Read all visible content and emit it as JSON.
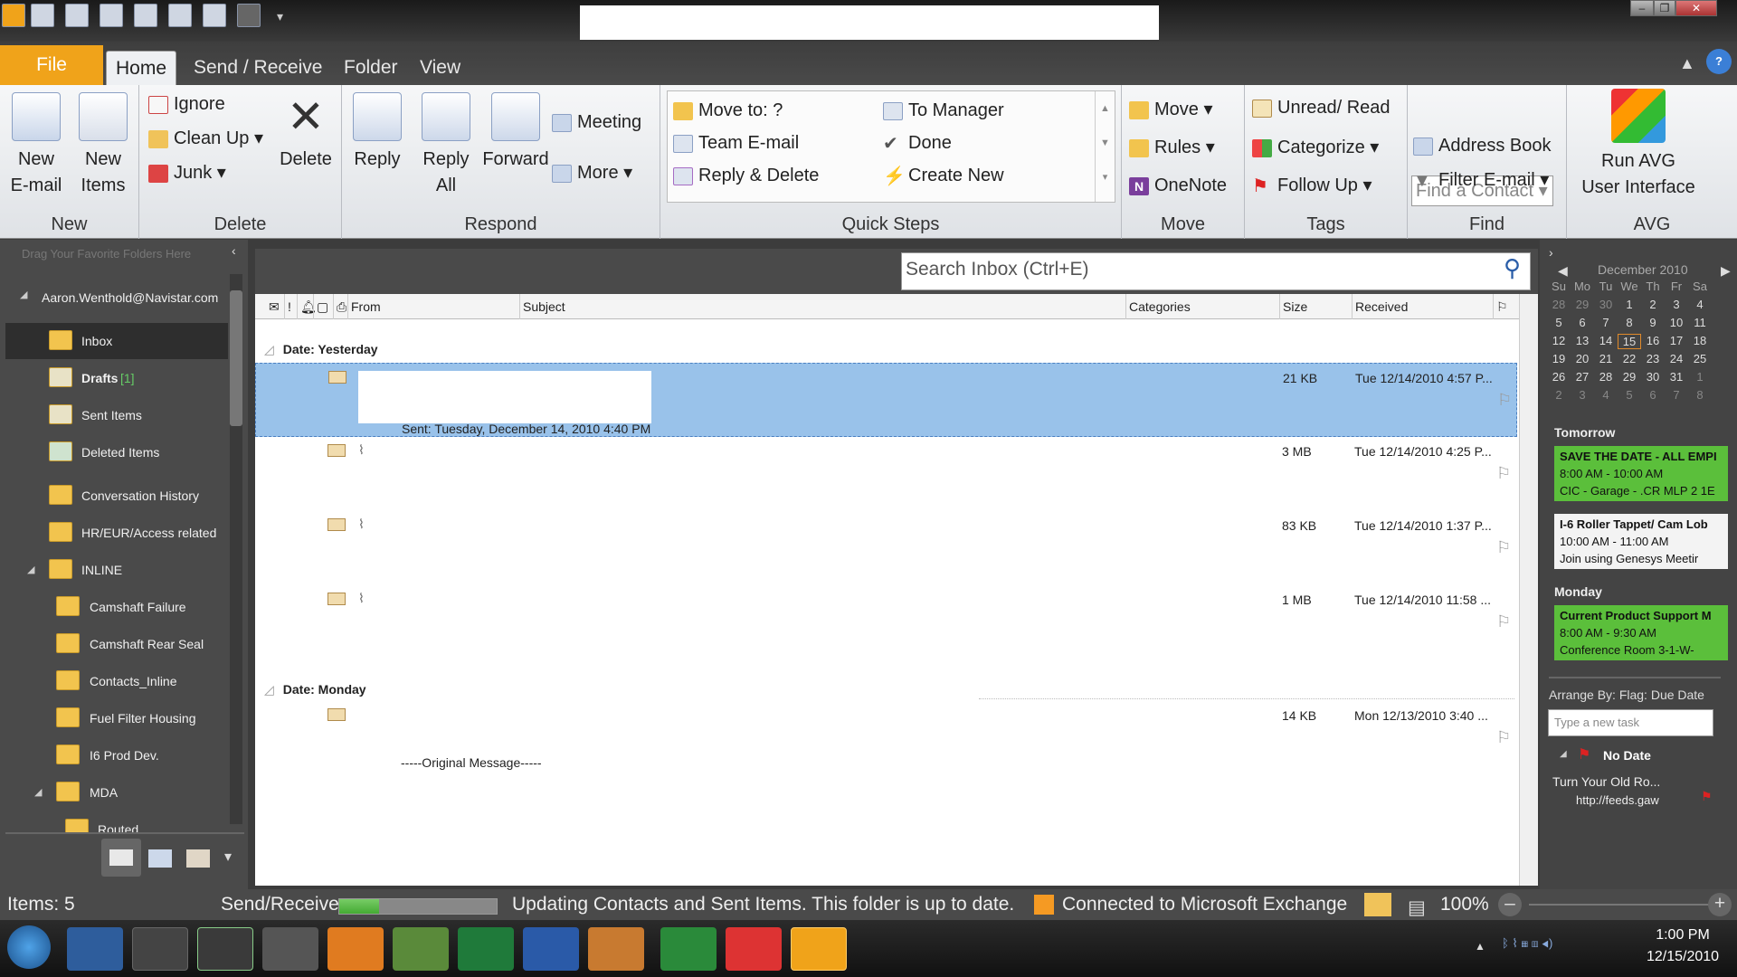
{
  "ribbon_tabs": [
    "File",
    "Home",
    "Send / Receive",
    "Folder",
    "View"
  ],
  "ribbon": {
    "new": {
      "new_email": "New\nE-mail",
      "new_items": "New\nItems",
      "label": "New"
    },
    "delete": {
      "ignore": "Ignore",
      "cleanup": "Clean Up",
      "junk": "Junk",
      "delete": "Delete",
      "label": "Delete"
    },
    "respond": {
      "reply": "Reply",
      "reply_all": "Reply\nAll",
      "forward": "Forward",
      "meeting": "Meeting",
      "more": "More",
      "label": "Respond"
    },
    "quicksteps": {
      "items": [
        "Move to: ?",
        "Team E-mail",
        "Reply & Delete",
        "To Manager",
        "Done",
        "Create New"
      ],
      "label": "Quick Steps"
    },
    "move": {
      "move": "Move",
      "rules": "Rules",
      "onenote": "OneNote",
      "label": "Move"
    },
    "tags": {
      "unread": "Unread/ Read",
      "categorize": "Categorize",
      "followup": "Follow Up",
      "label": "Tags"
    },
    "find": {
      "find_contact": "Find a Contact",
      "address_book": "Address Book",
      "filter_email": "Filter E-mail",
      "label": "Find"
    },
    "avg": {
      "run_avg": "Run AVG\nUser Interface",
      "label": "AVG"
    }
  },
  "nav": {
    "drag_hint": "Drag Your Favorite Folders Here",
    "account": "Aaron.Wenthold@Navistar.com",
    "folders": [
      "Inbox",
      "Drafts",
      "Sent Items",
      "Deleted Items",
      "Conversation History",
      "HR/EUR/Access related",
      "INLINE",
      "Camshaft Failure",
      "Camshaft Rear Seal",
      "Contacts_Inline",
      "Fuel Filter Housing",
      "I6 Prod Dev.",
      "MDA",
      "Routed"
    ],
    "drafts_count": "[1]"
  },
  "search": {
    "placeholder": "Search Inbox (Ctrl+E)"
  },
  "columns": {
    "from": "From",
    "subject": "Subject",
    "categories": "Categories",
    "size": "Size",
    "received": "Received"
  },
  "groups": {
    "yesterday": "Date: Yesterday",
    "monday": "Date: Monday"
  },
  "messages": [
    {
      "size": "21 KB",
      "received": "Tue 12/14/2010 4:57 P...",
      "preview": "Sent: Tuesday, December 14, 2010 4:40 PM"
    },
    {
      "size": "3 MB",
      "received": "Tue 12/14/2010 4:25 P..."
    },
    {
      "size": "83 KB",
      "received": "Tue 12/14/2010 1:37 P..."
    },
    {
      "size": "1 MB",
      "received": "Tue 12/14/2010 11:58 ..."
    },
    {
      "size": "14 KB",
      "received": "Mon 12/13/2010 3:40 ...",
      "preview": "-----Original Message-----"
    }
  ],
  "calendar": {
    "month": "December 2010",
    "dow": [
      "Su",
      "Mo",
      "Tu",
      "We",
      "Th",
      "Fr",
      "Sa"
    ],
    "weeks": [
      [
        "28",
        "29",
        "30",
        "1",
        "2",
        "3",
        "4"
      ],
      [
        "5",
        "6",
        "7",
        "8",
        "9",
        "10",
        "11"
      ],
      [
        "12",
        "13",
        "14",
        "15",
        "16",
        "17",
        "18"
      ],
      [
        "19",
        "20",
        "21",
        "22",
        "23",
        "24",
        "25"
      ],
      [
        "26",
        "27",
        "28",
        "29",
        "30",
        "31",
        "1"
      ],
      [
        "2",
        "3",
        "4",
        "5",
        "6",
        "7",
        "8"
      ]
    ]
  },
  "todo": {
    "tomorrow": "Tomorrow",
    "monday": "Monday",
    "appts": [
      {
        "title": "SAVE THE DATE - ALL EMPI",
        "time": "8:00 AM - 10:00 AM",
        "loc": "CIC - Garage - .CR MLP 2 1E"
      },
      {
        "title": "I-6 Roller Tappet/ Cam Lob",
        "time": "10:00 AM - 11:00 AM",
        "loc": "Join using Genesys Meetir"
      },
      {
        "title": "Current Product Support M",
        "time": "8:00 AM - 9:30 AM",
        "loc": "Conference Room 3-1-W-"
      }
    ],
    "arrange": "Arrange By: Flag: Due Date",
    "new_task": "Type a new task",
    "no_date": "No Date",
    "task": "Turn Your Old Ro...",
    "task_link": "http://feeds.gaw"
  },
  "status": {
    "items": "Items: 5",
    "sendreceive": "Send/Receive",
    "progress": 0.25,
    "message": "Updating Contacts and Sent Items.  This folder is up to date.",
    "exchange": "Connected to Microsoft Exchange",
    "zoom": "100%"
  },
  "clock": {
    "time": "1:00 PM",
    "date": "12/15/2010"
  },
  "colors": {
    "file_tab": "#f0a31a",
    "selected_row": "#99c2ea",
    "appt_green": "#5bbf3b"
  }
}
